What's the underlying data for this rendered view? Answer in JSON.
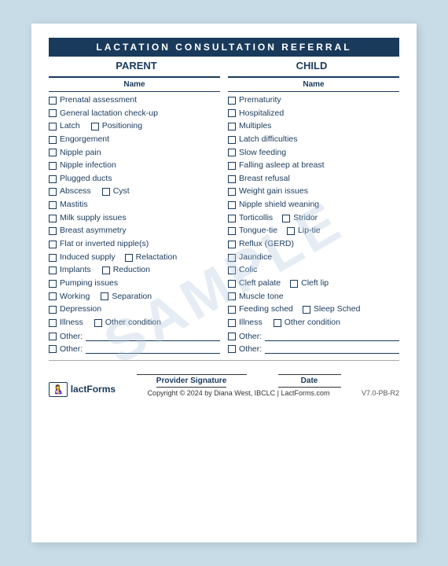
{
  "header": {
    "title": "LACTATION CONSULTATION REFERRAL",
    "col_parent": "PARENT",
    "col_child": "CHILD"
  },
  "watermark": "SAMPLE",
  "parent": {
    "name_label": "Name",
    "items": [
      {
        "label": "Prenatal assessment",
        "inline": false
      },
      {
        "label": "General lactation check-up",
        "inline": false
      },
      {
        "label": "Latch",
        "inline": true,
        "extra": "Positioning"
      },
      {
        "label": "Engorgement",
        "inline": false
      },
      {
        "label": "Nipple pain",
        "inline": false
      },
      {
        "label": "Nipple infection",
        "inline": false
      },
      {
        "label": "Plugged ducts",
        "inline": false
      },
      {
        "label": "Abscess",
        "inline": true,
        "extra": "Cyst"
      },
      {
        "label": "Mastitis",
        "inline": false
      },
      {
        "label": "Milk supply issues",
        "inline": false
      },
      {
        "label": "Breast asymmetry",
        "inline": false
      },
      {
        "label": "Flat or inverted nipple(s)",
        "inline": false
      },
      {
        "label": "Induced supply",
        "inline": true,
        "extra": "Relactation"
      },
      {
        "label": "Implants",
        "inline": true,
        "extra": "Reduction"
      },
      {
        "label": "Pumping issues",
        "inline": false
      },
      {
        "label": "Working",
        "inline": true,
        "extra": "Separation"
      },
      {
        "label": "Depression",
        "inline": false
      },
      {
        "label": "Illness",
        "inline": true,
        "extra": "Other condition"
      }
    ],
    "other1_label": "Other:",
    "other2_label": "Other:"
  },
  "child": {
    "name_label": "Name",
    "items": [
      {
        "label": "Prematurity",
        "inline": false
      },
      {
        "label": "Hospitalized",
        "inline": false
      },
      {
        "label": "Multiples",
        "inline": false
      },
      {
        "label": "Latch difficulties",
        "inline": false
      },
      {
        "label": "Slow feeding",
        "inline": false
      },
      {
        "label": "Falling asleep at breast",
        "inline": false
      },
      {
        "label": "Breast refusal",
        "inline": false
      },
      {
        "label": "Weight gain issues",
        "inline": false
      },
      {
        "label": "Nipple shield weaning",
        "inline": false
      },
      {
        "label": "Torticollis",
        "inline": true,
        "extra": "Stridor"
      },
      {
        "label": "Tongue-tie",
        "inline": true,
        "extra": "Lip-tie"
      },
      {
        "label": "Reflux (GERD)",
        "inline": false
      },
      {
        "label": "Jaundice",
        "inline": false
      },
      {
        "label": "Colic",
        "inline": false
      },
      {
        "label": "Cleft palate",
        "inline": true,
        "extra": "Cleft lip"
      },
      {
        "label": "Muscle tone",
        "inline": false
      },
      {
        "label": "Feeding sched",
        "inline": true,
        "extra": "Sleep Sched"
      },
      {
        "label": "Illness",
        "inline": true,
        "extra": "Other condition"
      }
    ],
    "other1_label": "Other:",
    "other2_label": "Other:"
  },
  "footer": {
    "logo_icon": "🤱",
    "logo_text": "lactForms",
    "sig_label": "Provider Signature",
    "date_label": "Date",
    "copyright": "Copyright © 2024 by Diana West, IBCLC | LactForms.com",
    "version": "V7.0-PB-R2"
  }
}
